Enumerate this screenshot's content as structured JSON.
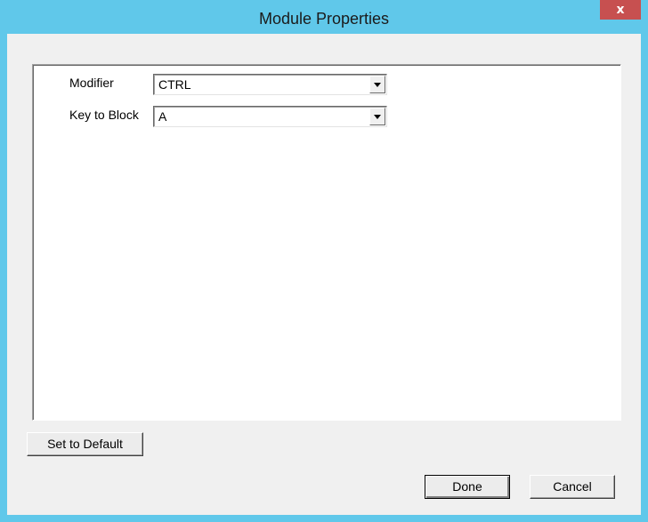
{
  "window": {
    "title": "Module Properties",
    "close_label": "x"
  },
  "form": {
    "modifier_label": "Modifier",
    "modifier_value": "CTRL",
    "key_label": "Key to Block",
    "key_value": "A"
  },
  "buttons": {
    "set_default_label": "Set to Default",
    "done_label": "Done",
    "cancel_label": "Cancel"
  },
  "colors": {
    "titlebar": "#60c8ea",
    "close_button": "#c75050",
    "client_background": "#f0f0f0"
  }
}
